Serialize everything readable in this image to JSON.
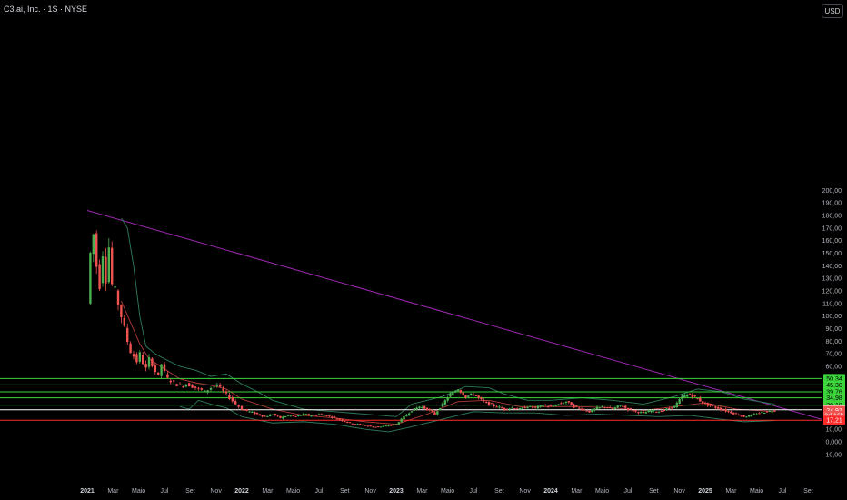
{
  "header": {
    "title": "C3.ai, Inc. · 1S · NYSE",
    "currency": "USD"
  },
  "colors": {
    "bg": "#000000",
    "up": "#26a69a",
    "down": "#ef5350",
    "upBody": "#4caf50",
    "trendline": "#9c27b0",
    "bandUpper": "#2e7d5b",
    "bandBasis": "#b23a3a",
    "green_level": "#3cd63c",
    "white_level": "#ffffff",
    "red_level": "#ff2a2a",
    "axis_text": "#b2b5be"
  },
  "chart_data": {
    "type": "candlestick",
    "y_ticks": [
      "200,00",
      "190,00",
      "180,00",
      "170,00",
      "160,00",
      "150,00",
      "140,00",
      "130,00",
      "120,00",
      "110,00",
      "100,00",
      "90,00",
      "80,00",
      "70,00",
      "60,00",
      "50,00",
      "40,00",
      "30,00",
      "20,00",
      "10,00",
      "0,000",
      "-10,00"
    ],
    "y_tick_values": [
      200,
      190,
      180,
      170,
      160,
      150,
      140,
      130,
      120,
      110,
      100,
      90,
      80,
      70,
      60,
      50,
      40,
      30,
      20,
      10,
      0,
      -10
    ],
    "x_ticks": [
      {
        "label": "2021",
        "t": 0.0,
        "bold": true
      },
      {
        "label": "Mar",
        "t": 0.167
      },
      {
        "label": "Maio",
        "t": 0.333
      },
      {
        "label": "Jul",
        "t": 0.5
      },
      {
        "label": "Set",
        "t": 0.667
      },
      {
        "label": "Nov",
        "t": 0.833
      },
      {
        "label": "2022",
        "t": 1.0,
        "bold": true
      },
      {
        "label": "Mar",
        "t": 1.167
      },
      {
        "label": "Maio",
        "t": 1.333
      },
      {
        "label": "Jul",
        "t": 1.5
      },
      {
        "label": "Set",
        "t": 1.667
      },
      {
        "label": "Nov",
        "t": 1.833
      },
      {
        "label": "2023",
        "t": 2.0,
        "bold": true
      },
      {
        "label": "Mar",
        "t": 2.167
      },
      {
        "label": "Maio",
        "t": 2.333
      },
      {
        "label": "Jul",
        "t": 2.5
      },
      {
        "label": "Set",
        "t": 2.667
      },
      {
        "label": "Nov",
        "t": 2.833
      },
      {
        "label": "2024",
        "t": 3.0,
        "bold": true
      },
      {
        "label": "Mar",
        "t": 3.167
      },
      {
        "label": "Maio",
        "t": 3.333
      },
      {
        "label": "Jul",
        "t": 3.5
      },
      {
        "label": "Set",
        "t": 3.667
      },
      {
        "label": "Nov",
        "t": 3.833
      },
      {
        "label": "2025",
        "t": 4.0,
        "bold": true
      },
      {
        "label": "Mar",
        "t": 4.167
      },
      {
        "label": "Maio",
        "t": 4.333
      },
      {
        "label": "Jul",
        "t": 4.5
      },
      {
        "label": "Set",
        "t": 4.667
      }
    ],
    "price_badges": [
      {
        "label": "50,34",
        "value": 50.34,
        "bg": "#3cd63c",
        "fg": "#000000"
      },
      {
        "label": "45,30",
        "value": 45.3,
        "bg": "#3cd63c",
        "fg": "#000000"
      },
      {
        "label": "39,76",
        "value": 39.76,
        "bg": "#3cd63c",
        "fg": "#000000"
      },
      {
        "label": "34,98",
        "value": 34.98,
        "bg": "#3cd63c",
        "fg": "#000000"
      },
      {
        "label": "29,19",
        "value": 29.19,
        "bg": "#3cd63c",
        "fg": "#000000"
      },
      {
        "label": "25,51",
        "value": 25.51,
        "bg": "#ffffff",
        "fg": "#000000"
      },
      {
        "label": "24,97",
        "value": 24.97,
        "bg": "#ef5350",
        "fg": "#ffffff"
      },
      {
        "label": "3d 16h",
        "value": 20.9,
        "bg": "#ef5350",
        "fg": "#ffffff"
      },
      {
        "label": "17,21",
        "value": 17.21,
        "bg": "#ff2a2a",
        "fg": "#ffffff"
      }
    ],
    "horizontal_levels": [
      {
        "value": 50.34,
        "color": "#3cd63c"
      },
      {
        "value": 45.3,
        "color": "#3cd63c"
      },
      {
        "value": 39.76,
        "color": "#3cd63c"
      },
      {
        "value": 34.98,
        "color": "#3cd63c"
      },
      {
        "value": 29.19,
        "color": "#3cd63c"
      },
      {
        "value": 25.51,
        "color": "#ffffff"
      },
      {
        "value": 17.21,
        "color": "#ff2a2a"
      }
    ],
    "trendline": {
      "from": {
        "t": 0.0,
        "v": 184
      },
      "to": {
        "t": 4.75,
        "v": 18
      }
    },
    "closes": [
      {
        "t": 0.0,
        "v": 110
      },
      {
        "t": 0.02,
        "v": 150
      },
      {
        "t": 0.04,
        "v": 165
      },
      {
        "t": 0.06,
        "v": 140
      },
      {
        "t": 0.08,
        "v": 125
      },
      {
        "t": 0.1,
        "v": 150
      },
      {
        "t": 0.12,
        "v": 130
      },
      {
        "t": 0.14,
        "v": 155
      },
      {
        "t": 0.16,
        "v": 125
      },
      {
        "t": 0.18,
        "v": 120
      },
      {
        "t": 0.2,
        "v": 110
      },
      {
        "t": 0.22,
        "v": 100
      },
      {
        "t": 0.24,
        "v": 90
      },
      {
        "t": 0.26,
        "v": 80
      },
      {
        "t": 0.28,
        "v": 72
      },
      {
        "t": 0.3,
        "v": 68
      },
      {
        "t": 0.32,
        "v": 64
      },
      {
        "t": 0.34,
        "v": 70
      },
      {
        "t": 0.36,
        "v": 63
      },
      {
        "t": 0.38,
        "v": 58
      },
      {
        "t": 0.4,
        "v": 66
      },
      {
        "t": 0.42,
        "v": 62
      },
      {
        "t": 0.44,
        "v": 56
      },
      {
        "t": 0.46,
        "v": 52
      },
      {
        "t": 0.48,
        "v": 62
      },
      {
        "t": 0.5,
        "v": 55
      },
      {
        "t": 0.52,
        "v": 50
      },
      {
        "t": 0.56,
        "v": 47
      },
      {
        "t": 0.6,
        "v": 44
      },
      {
        "t": 0.64,
        "v": 46
      },
      {
        "t": 0.68,
        "v": 44
      },
      {
        "t": 0.72,
        "v": 42
      },
      {
        "t": 0.76,
        "v": 40
      },
      {
        "t": 0.8,
        "v": 43
      },
      {
        "t": 0.84,
        "v": 45
      },
      {
        "t": 0.88,
        "v": 40
      },
      {
        "t": 0.92,
        "v": 35
      },
      {
        "t": 0.96,
        "v": 30
      },
      {
        "t": 1.0,
        "v": 26
      },
      {
        "t": 1.05,
        "v": 24
      },
      {
        "t": 1.1,
        "v": 22
      },
      {
        "t": 1.15,
        "v": 20
      },
      {
        "t": 1.2,
        "v": 22
      },
      {
        "t": 1.25,
        "v": 19
      },
      {
        "t": 1.3,
        "v": 21
      },
      {
        "t": 1.35,
        "v": 20
      },
      {
        "t": 1.4,
        "v": 22
      },
      {
        "t": 1.45,
        "v": 21
      },
      {
        "t": 1.5,
        "v": 22
      },
      {
        "t": 1.55,
        "v": 21
      },
      {
        "t": 1.6,
        "v": 19
      },
      {
        "t": 1.65,
        "v": 17
      },
      {
        "t": 1.7,
        "v": 15
      },
      {
        "t": 1.75,
        "v": 14
      },
      {
        "t": 1.8,
        "v": 13
      },
      {
        "t": 1.85,
        "v": 12
      },
      {
        "t": 1.9,
        "v": 12
      },
      {
        "t": 1.95,
        "v": 13
      },
      {
        "t": 2.0,
        "v": 14
      },
      {
        "t": 2.05,
        "v": 20
      },
      {
        "t": 2.1,
        "v": 25
      },
      {
        "t": 2.15,
        "v": 28
      },
      {
        "t": 2.2,
        "v": 26
      },
      {
        "t": 2.25,
        "v": 22
      },
      {
        "t": 2.3,
        "v": 30
      },
      {
        "t": 2.35,
        "v": 38
      },
      {
        "t": 2.4,
        "v": 42
      },
      {
        "t": 2.45,
        "v": 36
      },
      {
        "t": 2.5,
        "v": 38
      },
      {
        "t": 2.55,
        "v": 33
      },
      {
        "t": 2.6,
        "v": 30
      },
      {
        "t": 2.65,
        "v": 28
      },
      {
        "t": 2.7,
        "v": 26
      },
      {
        "t": 2.75,
        "v": 27
      },
      {
        "t": 2.8,
        "v": 26
      },
      {
        "t": 2.85,
        "v": 28
      },
      {
        "t": 2.9,
        "v": 27
      },
      {
        "t": 2.95,
        "v": 29
      },
      {
        "t": 3.0,
        "v": 28
      },
      {
        "t": 3.05,
        "v": 30
      },
      {
        "t": 3.1,
        "v": 32
      },
      {
        "t": 3.15,
        "v": 28
      },
      {
        "t": 3.2,
        "v": 26
      },
      {
        "t": 3.25,
        "v": 24
      },
      {
        "t": 3.3,
        "v": 27
      },
      {
        "t": 3.35,
        "v": 28
      },
      {
        "t": 3.4,
        "v": 26
      },
      {
        "t": 3.45,
        "v": 29
      },
      {
        "t": 3.5,
        "v": 26
      },
      {
        "t": 3.55,
        "v": 24
      },
      {
        "t": 3.6,
        "v": 23
      },
      {
        "t": 3.65,
        "v": 25
      },
      {
        "t": 3.7,
        "v": 24
      },
      {
        "t": 3.75,
        "v": 26
      },
      {
        "t": 3.8,
        "v": 28
      },
      {
        "t": 3.85,
        "v": 36
      },
      {
        "t": 3.9,
        "v": 38
      },
      {
        "t": 3.95,
        "v": 34
      },
      {
        "t": 4.0,
        "v": 30
      },
      {
        "t": 4.05,
        "v": 28
      },
      {
        "t": 4.1,
        "v": 26
      },
      {
        "t": 4.15,
        "v": 24
      },
      {
        "t": 4.2,
        "v": 22
      },
      {
        "t": 4.25,
        "v": 20
      },
      {
        "t": 4.3,
        "v": 21
      },
      {
        "t": 4.35,
        "v": 23
      },
      {
        "t": 4.4,
        "v": 24
      },
      {
        "t": 4.45,
        "v": 25
      }
    ],
    "band_upper": [
      {
        "t": 0.22,
        "v": 178
      },
      {
        "t": 0.26,
        "v": 170
      },
      {
        "t": 0.3,
        "v": 140
      },
      {
        "t": 0.34,
        "v": 100
      },
      {
        "t": 0.38,
        "v": 76
      },
      {
        "t": 0.44,
        "v": 70
      },
      {
        "t": 0.5,
        "v": 66
      },
      {
        "t": 0.6,
        "v": 60
      },
      {
        "t": 0.7,
        "v": 57
      },
      {
        "t": 0.8,
        "v": 52
      },
      {
        "t": 0.9,
        "v": 54
      },
      {
        "t": 1.0,
        "v": 46
      },
      {
        "t": 1.1,
        "v": 40
      },
      {
        "t": 1.2,
        "v": 33
      },
      {
        "t": 1.4,
        "v": 26
      },
      {
        "t": 1.6,
        "v": 24
      },
      {
        "t": 1.8,
        "v": 22
      },
      {
        "t": 2.0,
        "v": 20
      },
      {
        "t": 2.1,
        "v": 30
      },
      {
        "t": 2.3,
        "v": 36
      },
      {
        "t": 2.45,
        "v": 44
      },
      {
        "t": 2.6,
        "v": 43
      },
      {
        "t": 2.7,
        "v": 38
      },
      {
        "t": 2.85,
        "v": 33
      },
      {
        "t": 3.0,
        "v": 33
      },
      {
        "t": 3.2,
        "v": 35
      },
      {
        "t": 3.4,
        "v": 33
      },
      {
        "t": 3.6,
        "v": 30
      },
      {
        "t": 3.8,
        "v": 36
      },
      {
        "t": 3.95,
        "v": 42
      },
      {
        "t": 4.1,
        "v": 40
      },
      {
        "t": 4.25,
        "v": 34
      },
      {
        "t": 4.45,
        "v": 30
      }
    ],
    "band_lower": [
      {
        "t": 0.6,
        "v": 28
      },
      {
        "t": 0.66,
        "v": 26
      },
      {
        "t": 0.72,
        "v": 33
      },
      {
        "t": 0.8,
        "v": 30
      },
      {
        "t": 0.9,
        "v": 27
      },
      {
        "t": 1.0,
        "v": 20
      },
      {
        "t": 1.2,
        "v": 15
      },
      {
        "t": 1.4,
        "v": 16
      },
      {
        "t": 1.6,
        "v": 14
      },
      {
        "t": 1.8,
        "v": 10
      },
      {
        "t": 1.95,
        "v": 8
      },
      {
        "t": 2.1,
        "v": 12
      },
      {
        "t": 2.3,
        "v": 18
      },
      {
        "t": 2.5,
        "v": 24
      },
      {
        "t": 2.7,
        "v": 23
      },
      {
        "t": 2.9,
        "v": 23
      },
      {
        "t": 3.1,
        "v": 21
      },
      {
        "t": 3.3,
        "v": 22
      },
      {
        "t": 3.5,
        "v": 21
      },
      {
        "t": 3.7,
        "v": 20
      },
      {
        "t": 3.9,
        "v": 21
      },
      {
        "t": 4.1,
        "v": 18
      },
      {
        "t": 4.25,
        "v": 16
      },
      {
        "t": 4.45,
        "v": 17
      }
    ],
    "band_basis": [
      {
        "t": 0.22,
        "v": 112
      },
      {
        "t": 0.28,
        "v": 95
      },
      {
        "t": 0.34,
        "v": 78
      },
      {
        "t": 0.4,
        "v": 66
      },
      {
        "t": 0.5,
        "v": 58
      },
      {
        "t": 0.6,
        "v": 50
      },
      {
        "t": 0.7,
        "v": 47
      },
      {
        "t": 0.8,
        "v": 45
      },
      {
        "t": 0.9,
        "v": 42
      },
      {
        "t": 1.0,
        "v": 34
      },
      {
        "t": 1.2,
        "v": 26
      },
      {
        "t": 1.4,
        "v": 21
      },
      {
        "t": 1.6,
        "v": 19
      },
      {
        "t": 1.8,
        "v": 16
      },
      {
        "t": 2.0,
        "v": 14
      },
      {
        "t": 2.2,
        "v": 22
      },
      {
        "t": 2.4,
        "v": 32
      },
      {
        "t": 2.6,
        "v": 33
      },
      {
        "t": 2.8,
        "v": 28
      },
      {
        "t": 3.0,
        "v": 28
      },
      {
        "t": 3.2,
        "v": 28
      },
      {
        "t": 3.4,
        "v": 27
      },
      {
        "t": 3.6,
        "v": 25
      },
      {
        "t": 3.8,
        "v": 28
      },
      {
        "t": 4.0,
        "v": 31
      },
      {
        "t": 4.2,
        "v": 26
      },
      {
        "t": 4.45,
        "v": 24
      }
    ]
  }
}
